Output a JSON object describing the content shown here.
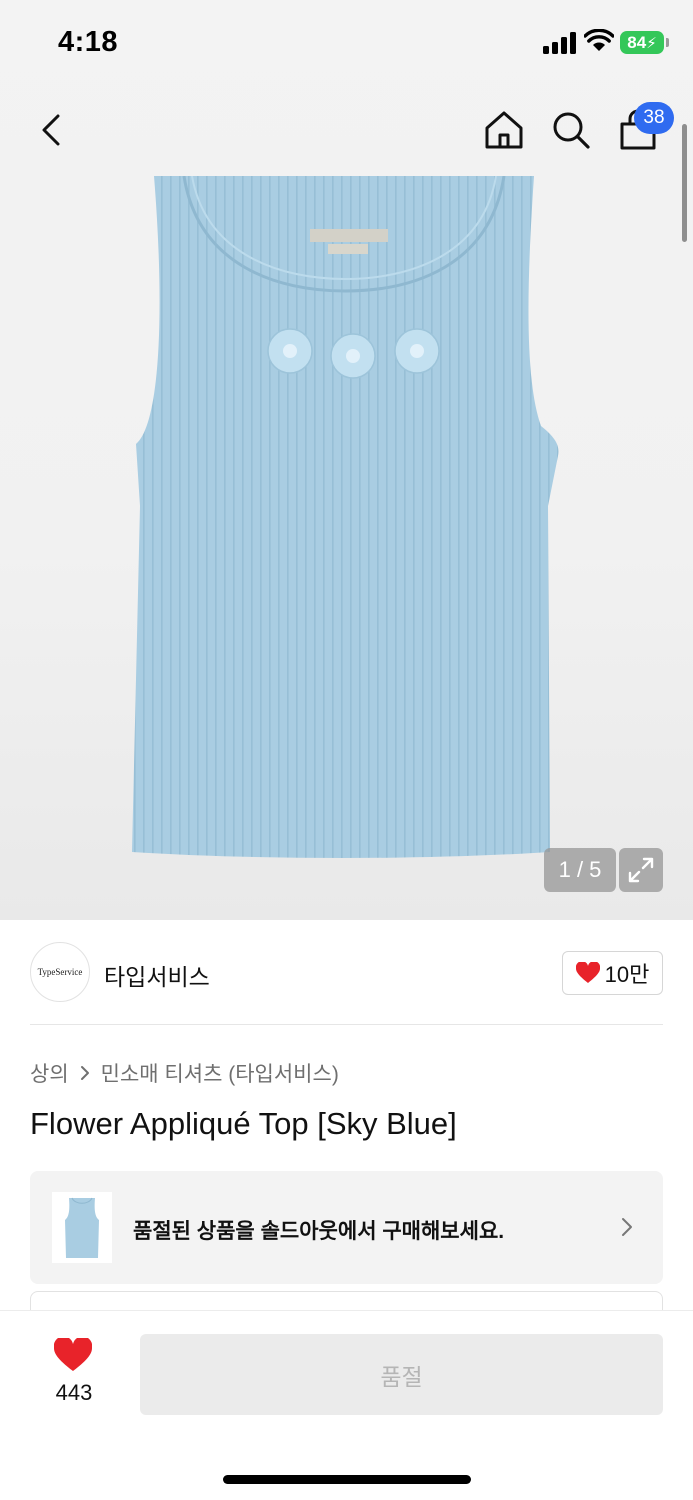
{
  "status_bar": {
    "time": "4:18",
    "battery": "84"
  },
  "nav": {
    "back_icon": "chevron-left-icon",
    "home_icon": "home-icon",
    "search_icon": "search-icon",
    "bag_icon": "shopping-bag-icon",
    "bag_badge": "38"
  },
  "gallery": {
    "counter": "1 / 5",
    "expand_icon": "expand-icon",
    "product_color": "#a9cde2"
  },
  "brand": {
    "logo_text": "TypeService",
    "name": "타입서비스",
    "likes": "10만",
    "heart_color": "#e8232a"
  },
  "breadcrumb": {
    "category": "상의",
    "subcategory": "민소매 티셔츠 (타입서비스)"
  },
  "product": {
    "title": "Flower Appliqué Top [Sky Blue]"
  },
  "soldout_banner": {
    "text": "품절된 상품을 솔드아웃에서 구매해보세요."
  },
  "bottom_bar": {
    "wish_count": "443",
    "buy_label": "품절"
  }
}
